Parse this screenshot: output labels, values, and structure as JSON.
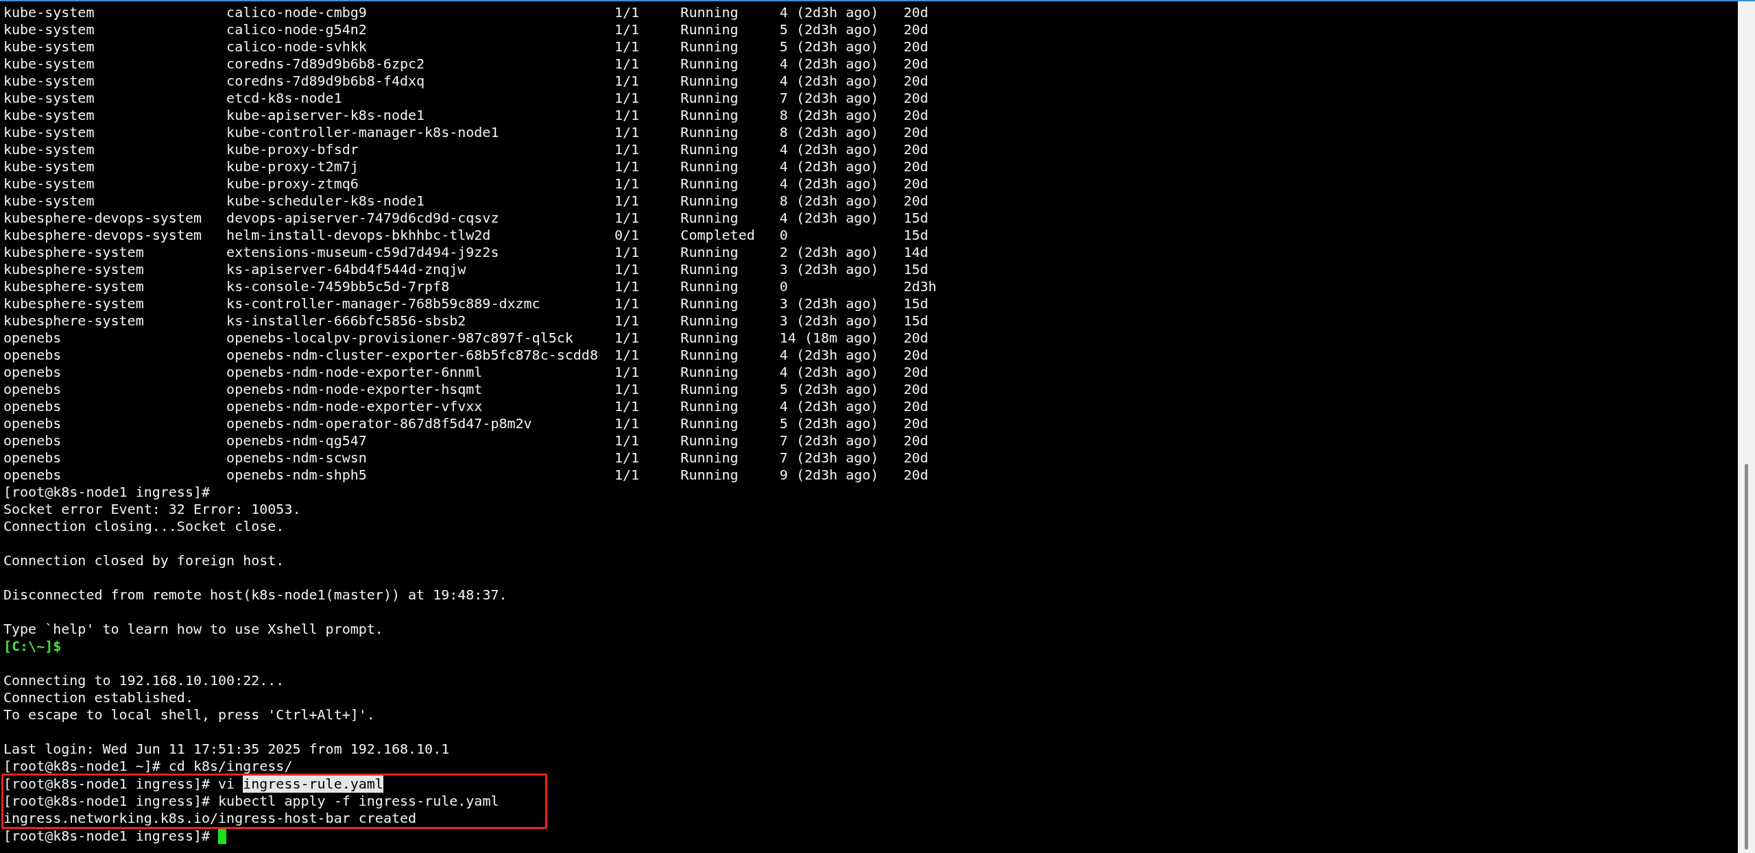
{
  "pods": [
    {
      "namespace": "kube-system",
      "name": "calico-node-cmbg9",
      "ready": "1/1",
      "status": "Running",
      "restarts": "4 (2d3h ago)",
      "age": "20d"
    },
    {
      "namespace": "kube-system",
      "name": "calico-node-g54n2",
      "ready": "1/1",
      "status": "Running",
      "restarts": "5 (2d3h ago)",
      "age": "20d"
    },
    {
      "namespace": "kube-system",
      "name": "calico-node-svhkk",
      "ready": "1/1",
      "status": "Running",
      "restarts": "5 (2d3h ago)",
      "age": "20d"
    },
    {
      "namespace": "kube-system",
      "name": "coredns-7d89d9b6b8-6zpc2",
      "ready": "1/1",
      "status": "Running",
      "restarts": "4 (2d3h ago)",
      "age": "20d"
    },
    {
      "namespace": "kube-system",
      "name": "coredns-7d89d9b6b8-f4dxq",
      "ready": "1/1",
      "status": "Running",
      "restarts": "4 (2d3h ago)",
      "age": "20d"
    },
    {
      "namespace": "kube-system",
      "name": "etcd-k8s-node1",
      "ready": "1/1",
      "status": "Running",
      "restarts": "7 (2d3h ago)",
      "age": "20d"
    },
    {
      "namespace": "kube-system",
      "name": "kube-apiserver-k8s-node1",
      "ready": "1/1",
      "status": "Running",
      "restarts": "8 (2d3h ago)",
      "age": "20d"
    },
    {
      "namespace": "kube-system",
      "name": "kube-controller-manager-k8s-node1",
      "ready": "1/1",
      "status": "Running",
      "restarts": "8 (2d3h ago)",
      "age": "20d"
    },
    {
      "namespace": "kube-system",
      "name": "kube-proxy-bfsdr",
      "ready": "1/1",
      "status": "Running",
      "restarts": "4 (2d3h ago)",
      "age": "20d"
    },
    {
      "namespace": "kube-system",
      "name": "kube-proxy-t2m7j",
      "ready": "1/1",
      "status": "Running",
      "restarts": "4 (2d3h ago)",
      "age": "20d"
    },
    {
      "namespace": "kube-system",
      "name": "kube-proxy-ztmq6",
      "ready": "1/1",
      "status": "Running",
      "restarts": "4 (2d3h ago)",
      "age": "20d"
    },
    {
      "namespace": "kube-system",
      "name": "kube-scheduler-k8s-node1",
      "ready": "1/1",
      "status": "Running",
      "restarts": "8 (2d3h ago)",
      "age": "20d"
    },
    {
      "namespace": "kubesphere-devops-system",
      "name": "devops-apiserver-7479d6cd9d-cqsvz",
      "ready": "1/1",
      "status": "Running",
      "restarts": "4 (2d3h ago)",
      "age": "15d"
    },
    {
      "namespace": "kubesphere-devops-system",
      "name": "helm-install-devops-bkhhbc-tlw2d",
      "ready": "0/1",
      "status": "Completed",
      "restarts": "0",
      "age": "15d"
    },
    {
      "namespace": "kubesphere-system",
      "name": "extensions-museum-c59d7d494-j9z2s",
      "ready": "1/1",
      "status": "Running",
      "restarts": "2 (2d3h ago)",
      "age": "14d"
    },
    {
      "namespace": "kubesphere-system",
      "name": "ks-apiserver-64bd4f544d-znqjw",
      "ready": "1/1",
      "status": "Running",
      "restarts": "3 (2d3h ago)",
      "age": "15d"
    },
    {
      "namespace": "kubesphere-system",
      "name": "ks-console-7459bb5c5d-7rpf8",
      "ready": "1/1",
      "status": "Running",
      "restarts": "0",
      "age": "2d3h"
    },
    {
      "namespace": "kubesphere-system",
      "name": "ks-controller-manager-768b59c889-dxzmc",
      "ready": "1/1",
      "status": "Running",
      "restarts": "3 (2d3h ago)",
      "age": "15d"
    },
    {
      "namespace": "kubesphere-system",
      "name": "ks-installer-666bfc5856-sbsb2",
      "ready": "1/1",
      "status": "Running",
      "restarts": "3 (2d3h ago)",
      "age": "15d"
    },
    {
      "namespace": "openebs",
      "name": "openebs-localpv-provisioner-987c897f-ql5ck",
      "ready": "1/1",
      "status": "Running",
      "restarts": "14 (18m ago)",
      "age": "20d"
    },
    {
      "namespace": "openebs",
      "name": "openebs-ndm-cluster-exporter-68b5fc878c-scdd8",
      "ready": "1/1",
      "status": "Running",
      "restarts": "4 (2d3h ago)",
      "age": "20d"
    },
    {
      "namespace": "openebs",
      "name": "openebs-ndm-node-exporter-6nnml",
      "ready": "1/1",
      "status": "Running",
      "restarts": "4 (2d3h ago)",
      "age": "20d"
    },
    {
      "namespace": "openebs",
      "name": "openebs-ndm-node-exporter-hsqmt",
      "ready": "1/1",
      "status": "Running",
      "restarts": "5 (2d3h ago)",
      "age": "20d"
    },
    {
      "namespace": "openebs",
      "name": "openebs-ndm-node-exporter-vfvxx",
      "ready": "1/1",
      "status": "Running",
      "restarts": "4 (2d3h ago)",
      "age": "20d"
    },
    {
      "namespace": "openebs",
      "name": "openebs-ndm-operator-867d8f5d47-p8m2v",
      "ready": "1/1",
      "status": "Running",
      "restarts": "5 (2d3h ago)",
      "age": "20d"
    },
    {
      "namespace": "openebs",
      "name": "openebs-ndm-qg547",
      "ready": "1/1",
      "status": "Running",
      "restarts": "7 (2d3h ago)",
      "age": "20d"
    },
    {
      "namespace": "openebs",
      "name": "openebs-ndm-scwsn",
      "ready": "1/1",
      "status": "Running",
      "restarts": "7 (2d3h ago)",
      "age": "20d"
    },
    {
      "namespace": "openebs",
      "name": "openebs-ndm-shph5",
      "ready": "1/1",
      "status": "Running",
      "restarts": "9 (2d3h ago)",
      "age": "20d"
    }
  ],
  "lines": [
    {
      "kind": "prompt",
      "prompt": "[root@k8s-node1 ingress]#",
      "boxed": false,
      "cursor": false
    },
    {
      "kind": "output",
      "text": "Socket error Event: 32 Error: 10053.",
      "boxed": false
    },
    {
      "kind": "output",
      "text": "Connection closing...Socket close.",
      "boxed": false
    },
    {
      "kind": "blank"
    },
    {
      "kind": "output",
      "text": "Connection closed by foreign host.",
      "boxed": false
    },
    {
      "kind": "blank"
    },
    {
      "kind": "output",
      "text": "Disconnected from remote host(k8s-node1(master)) at 19:48:37.",
      "boxed": false
    },
    {
      "kind": "blank"
    },
    {
      "kind": "output",
      "text": "Type `help' to learn how to use Xshell prompt.",
      "boxed": false
    },
    {
      "kind": "local_prompt",
      "text": "[C:\\~]$",
      "boxed": false
    },
    {
      "kind": "blank"
    },
    {
      "kind": "output",
      "text": "Connecting to 192.168.10.100:22...",
      "boxed": false
    },
    {
      "kind": "output",
      "text": "Connection established.",
      "boxed": false
    },
    {
      "kind": "output",
      "text": "To escape to local shell, press 'Ctrl+Alt+]'.",
      "boxed": false
    },
    {
      "kind": "blank"
    },
    {
      "kind": "output",
      "text": "Last login: Wed Jun 11 17:51:35 2025 from 192.168.10.1",
      "boxed": false
    },
    {
      "kind": "prompt",
      "prompt": "[root@k8s-node1 ~]#",
      "command": "cd k8s/ingress/",
      "boxed": false,
      "cursor": false
    },
    {
      "kind": "prompt",
      "prompt": "[root@k8s-node1 ingress]#",
      "command": "vi",
      "selected_text": "ingress-rule.yaml",
      "boxed": true,
      "cursor": false
    },
    {
      "kind": "prompt",
      "prompt": "[root@k8s-node1 ingress]#",
      "command": "kubectl apply -f ingress-rule.yaml",
      "boxed": true,
      "cursor": false
    },
    {
      "kind": "output",
      "text": "ingress.networking.k8s.io/ingress-host-bar created",
      "boxed": true
    },
    {
      "kind": "prompt",
      "prompt": "[root@k8s-node1 ingress]#",
      "boxed": false,
      "cursor": true
    }
  ]
}
